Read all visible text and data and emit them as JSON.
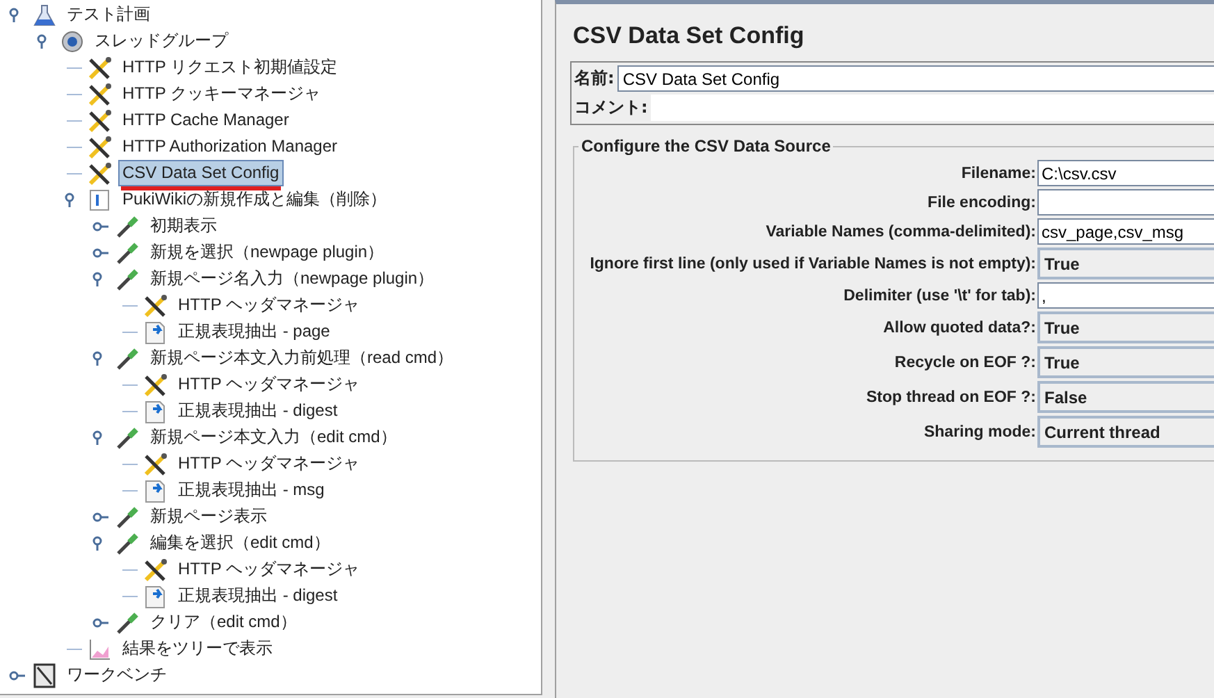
{
  "tree": [
    {
      "label": "テスト計画",
      "kind": "plan",
      "expanded": true,
      "children": [
        {
          "label": "スレッドグループ",
          "kind": "thread",
          "expanded": true,
          "children": [
            {
              "label": "HTTP リクエスト初期値設定",
              "kind": "config",
              "selected": false
            },
            {
              "label": "HTTP クッキーマネージャ",
              "kind": "config",
              "selected": false
            },
            {
              "label": "HTTP Cache Manager",
              "kind": "config",
              "selected": false
            },
            {
              "label": "HTTP Authorization Manager",
              "kind": "config",
              "selected": false
            },
            {
              "label": "CSV Data Set Config",
              "kind": "config",
              "selected": true,
              "underlined": true
            },
            {
              "label": "PukiWikiの新規作成と編集（削除）",
              "kind": "controller",
              "expanded": true,
              "children": [
                {
                  "label": "初期表示",
                  "kind": "sampler",
                  "expanded": false
                },
                {
                  "label": "新規を選択（newpage plugin）",
                  "kind": "sampler",
                  "expanded": false
                },
                {
                  "label": "新規ページ名入力（newpage plugin）",
                  "kind": "sampler",
                  "expanded": true,
                  "children": [
                    {
                      "label": "HTTP ヘッダマネージャ",
                      "kind": "config",
                      "selected": false
                    },
                    {
                      "label": "正規表現抽出 - page",
                      "kind": "extractor",
                      "selected": false
                    }
                  ]
                },
                {
                  "label": "新規ページ本文入力前処理（read cmd）",
                  "kind": "sampler",
                  "expanded": true,
                  "children": [
                    {
                      "label": "HTTP ヘッダマネージャ",
                      "kind": "config",
                      "selected": false
                    },
                    {
                      "label": "正規表現抽出 - digest",
                      "kind": "extractor",
                      "selected": false
                    }
                  ]
                },
                {
                  "label": "新規ページ本文入力（edit cmd）",
                  "kind": "sampler",
                  "expanded": true,
                  "children": [
                    {
                      "label": "HTTP ヘッダマネージャ",
                      "kind": "config",
                      "selected": false
                    },
                    {
                      "label": "正規表現抽出 - msg",
                      "kind": "extractor",
                      "selected": false
                    }
                  ]
                },
                {
                  "label": "新規ページ表示",
                  "kind": "sampler",
                  "expanded": false
                },
                {
                  "label": "編集を選択（edit cmd）",
                  "kind": "sampler",
                  "expanded": true,
                  "children": [
                    {
                      "label": "HTTP ヘッダマネージャ",
                      "kind": "config",
                      "selected": false
                    },
                    {
                      "label": "正規表現抽出 - digest",
                      "kind": "extractor",
                      "selected": false
                    }
                  ]
                },
                {
                  "label": "クリア（edit cmd）",
                  "kind": "sampler",
                  "expanded": false
                }
              ]
            },
            {
              "label": "結果をツリーで表示",
              "kind": "listener",
              "selected": false
            }
          ]
        }
      ]
    },
    {
      "label": "ワークベンチ",
      "kind": "workbench",
      "expanded": false
    }
  ],
  "panel": {
    "title": "CSV Data Set Config",
    "name": {
      "label": "名前:",
      "value": "CSV Data Set Config"
    },
    "comment": {
      "label": "コメント:"
    },
    "group": {
      "legend": "Configure the CSV Data Source",
      "fields": [
        {
          "label": "Filename:",
          "kind": "text",
          "value": "C:\\csv.csv"
        },
        {
          "label": "File encoding:",
          "kind": "text"
        },
        {
          "label": "Variable Names (comma-delimited):",
          "kind": "text",
          "value": "csv_page,csv_msg"
        },
        {
          "label": "Ignore first line (only used if Variable Names is not empty):",
          "kind": "combo",
          "value": "True"
        },
        {
          "label": "Delimiter (use '\\t' for tab):",
          "kind": "text",
          "value": ","
        },
        {
          "label": "Allow quoted data?:",
          "kind": "combo",
          "value": "True"
        },
        {
          "label": "Recycle on EOF ?:",
          "kind": "combo",
          "value": "True"
        },
        {
          "label": "Stop thread on EOF ?:",
          "kind": "combo",
          "value": "False"
        },
        {
          "label": "Sharing mode:",
          "kind": "combo",
          "value": "Current thread"
        }
      ]
    }
  }
}
